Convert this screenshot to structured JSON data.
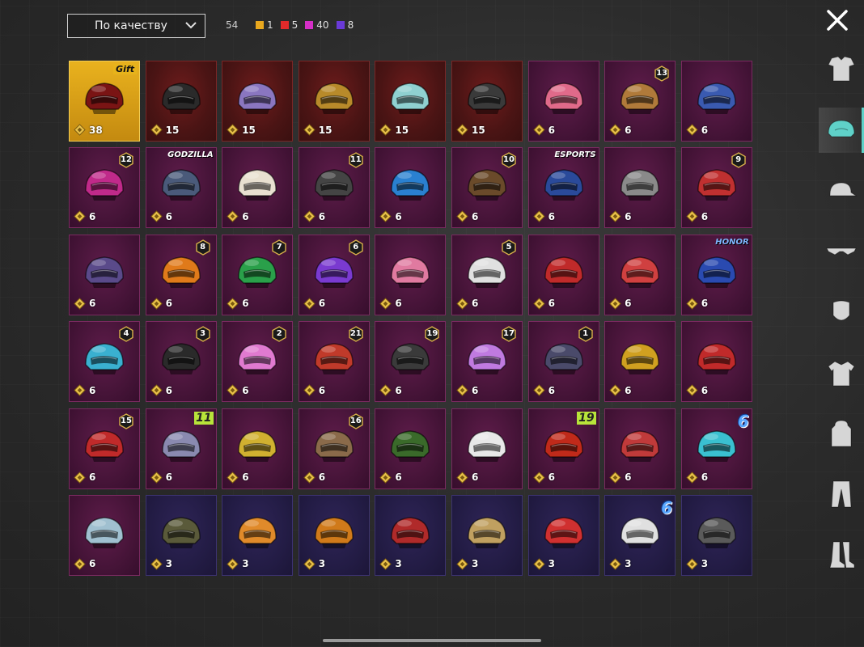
{
  "filter": {
    "sort_label": "По качеству"
  },
  "summary": {
    "total": "54",
    "legend": [
      {
        "color": "#e9a81e",
        "count": "1"
      },
      {
        "color": "#e02a2a",
        "count": "5"
      },
      {
        "color": "#d52fc7",
        "count": "40"
      },
      {
        "color": "#6a3ad6",
        "count": "8"
      }
    ]
  },
  "colors": {
    "legendary": "#e9b21e",
    "red": "#4a1414",
    "pink": "#461438",
    "purple": "#231c45",
    "active_tab": "#5fd1c8"
  },
  "sidebar": {
    "items": [
      {
        "icon": "outfit-icon"
      },
      {
        "icon": "helmet-icon",
        "active": true
      },
      {
        "icon": "cap-icon"
      },
      {
        "icon": "glasses-icon"
      },
      {
        "icon": "mask-icon"
      },
      {
        "icon": "jacket-icon"
      },
      {
        "icon": "backpack-icon"
      },
      {
        "icon": "pants-icon"
      },
      {
        "icon": "boots-icon"
      }
    ]
  },
  "items": [
    {
      "quality": "legendary",
      "count": "38",
      "color": "#7a1414",
      "tag": "Gift",
      "tag_style": "gold"
    },
    {
      "quality": "red",
      "count": "15",
      "color": "#2a2a2a"
    },
    {
      "quality": "red",
      "count": "15",
      "color": "#8a76c0"
    },
    {
      "quality": "red",
      "count": "15",
      "color": "#b88a2a"
    },
    {
      "quality": "red",
      "count": "15",
      "color": "#8fd0d0"
    },
    {
      "quality": "red",
      "count": "15",
      "color": "#3a3a3a"
    },
    {
      "quality": "pink",
      "count": "6",
      "color": "#e06a8a"
    },
    {
      "quality": "pink",
      "count": "6",
      "color": "#b07a3a",
      "level": "13"
    },
    {
      "quality": "pink",
      "count": "6",
      "color": "#3a5ab0"
    },
    {
      "quality": "pink",
      "count": "6",
      "color": "#c02a8a",
      "level": "12"
    },
    {
      "quality": "pink",
      "count": "6",
      "color": "#4a5a7a",
      "tag": "GODZILLA"
    },
    {
      "quality": "pink",
      "count": "6",
      "color": "#e8e0d0"
    },
    {
      "quality": "pink",
      "count": "6",
      "color": "#444444",
      "level": "11"
    },
    {
      "quality": "pink",
      "count": "6",
      "color": "#2a80d0"
    },
    {
      "quality": "pink",
      "count": "6",
      "color": "#6a4a2a",
      "level": "10"
    },
    {
      "quality": "pink",
      "count": "6",
      "color": "#2a4a9a",
      "tag": "ESPORTS"
    },
    {
      "quality": "pink",
      "count": "6",
      "color": "#8a8a8a"
    },
    {
      "quality": "pink",
      "count": "6",
      "color": "#c03030",
      "level": "9"
    },
    {
      "quality": "pink",
      "count": "6",
      "color": "#5a4a8a"
    },
    {
      "quality": "pink",
      "count": "6",
      "color": "#e07a1a",
      "level": "8"
    },
    {
      "quality": "pink",
      "count": "6",
      "color": "#2aa04a",
      "level": "7"
    },
    {
      "quality": "pink",
      "count": "6",
      "color": "#7a3ad0",
      "level": "6"
    },
    {
      "quality": "pink",
      "count": "6",
      "color": "#e07aa0"
    },
    {
      "quality": "pink",
      "count": "6",
      "color": "#e0e0e0",
      "level": "5"
    },
    {
      "quality": "pink",
      "count": "6",
      "color": "#c02a2a"
    },
    {
      "quality": "pink",
      "count": "6",
      "color": "#d04040"
    },
    {
      "quality": "pink",
      "count": "6",
      "color": "#2a4ab0",
      "tag": "HONOR",
      "tag_style": "honor"
    },
    {
      "quality": "pink",
      "count": "6",
      "color": "#3ab0d0",
      "level": "4"
    },
    {
      "quality": "pink",
      "count": "6",
      "color": "#2a2a2a",
      "level": "3"
    },
    {
      "quality": "pink",
      "count": "6",
      "color": "#e07ad0",
      "level": "2"
    },
    {
      "quality": "pink",
      "count": "6",
      "color": "#c03a2a",
      "level": "21"
    },
    {
      "quality": "pink",
      "count": "6",
      "color": "#3a3a3a",
      "level": "19"
    },
    {
      "quality": "pink",
      "count": "6",
      "color": "#c07ae0",
      "level": "17"
    },
    {
      "quality": "pink",
      "count": "6",
      "color": "#4a4a6a",
      "level": "1"
    },
    {
      "quality": "pink",
      "count": "6",
      "color": "#d0a020"
    },
    {
      "quality": "pink",
      "count": "6",
      "color": "#c02a2a"
    },
    {
      "quality": "pink",
      "count": "6",
      "color": "#c02a2a",
      "level": "15"
    },
    {
      "quality": "pink",
      "count": "6",
      "color": "#8a8ab0",
      "tag": "11",
      "tag_style": "lime"
    },
    {
      "quality": "pink",
      "count": "6",
      "color": "#d0b030"
    },
    {
      "quality": "pink",
      "count": "6",
      "color": "#8a6a4a",
      "level": "16"
    },
    {
      "quality": "pink",
      "count": "6",
      "color": "#3a6a2a"
    },
    {
      "quality": "pink",
      "count": "6",
      "color": "#e8e8e8"
    },
    {
      "quality": "pink",
      "count": "6",
      "color": "#c02a1a",
      "tag": "19",
      "tag_style": "lime"
    },
    {
      "quality": "pink",
      "count": "6",
      "color": "#c03a3a"
    },
    {
      "quality": "pink",
      "count": "6",
      "color": "#3ac0d0",
      "tag": "6",
      "tag_style": "big6"
    },
    {
      "quality": "pink",
      "count": "6",
      "color": "#a0c0d0"
    },
    {
      "quality": "purple",
      "count": "3",
      "color": "#5a5a3a"
    },
    {
      "quality": "purple",
      "count": "3",
      "color": "#e08a2a"
    },
    {
      "quality": "purple",
      "count": "3",
      "color": "#d07a1a"
    },
    {
      "quality": "purple",
      "count": "3",
      "color": "#b02a2a"
    },
    {
      "quality": "purple",
      "count": "3",
      "color": "#c0a060"
    },
    {
      "quality": "purple",
      "count": "3",
      "color": "#d03030"
    },
    {
      "quality": "purple",
      "count": "3",
      "color": "#e0e0e0",
      "tag": "6",
      "tag_style": "big6"
    },
    {
      "quality": "purple",
      "count": "3",
      "color": "#5a5a5a"
    }
  ]
}
